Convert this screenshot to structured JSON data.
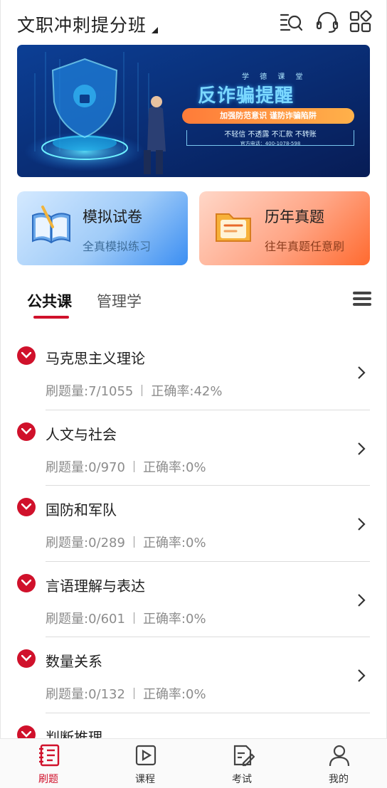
{
  "header": {
    "title": "文职冲刺提分班",
    "icons": [
      "search-list-icon",
      "headset-icon",
      "apps-grid-icon"
    ]
  },
  "banner": {
    "kicker": "学 德 课 堂",
    "headline": "反诈骗提醒",
    "pill": "加强防范意识 谨防诈骗陷阱",
    "slogan": "不轻信 不透露 不汇款 不转账",
    "phone": "官方电话：400-1078-598",
    "colors": {
      "background": "#0a2a6e",
      "accent": "#ff8a3d"
    }
  },
  "cards": {
    "mock": {
      "title": "模拟试卷",
      "subtitle": "全真模拟练习",
      "icon": "open-book-icon"
    },
    "past": {
      "title": "历年真题",
      "subtitle": "往年真题任意刷",
      "icon": "folder-icon"
    }
  },
  "tabs": {
    "items": [
      "公共课",
      "管理学"
    ],
    "active_index": 0,
    "menu_icon": "menu-icon"
  },
  "subjects": [
    {
      "name": "马克思主义理论",
      "count": "刷题量:7/1055",
      "accuracy": "正确率:42%"
    },
    {
      "name": "人文与社会",
      "count": "刷题量:0/970",
      "accuracy": "正确率:0%"
    },
    {
      "name": "国防和军队",
      "count": "刷题量:0/289",
      "accuracy": "正确率:0%"
    },
    {
      "name": "言语理解与表达",
      "count": "刷题量:0/601",
      "accuracy": "正确率:0%"
    },
    {
      "name": "数量关系",
      "count": "刷题量:0/132",
      "accuracy": "正确率:0%"
    },
    {
      "name": "判断推理",
      "count": "",
      "accuracy": ""
    }
  ],
  "bottom_nav": {
    "items": [
      {
        "label": "刷题",
        "icon": "practice-icon",
        "active": true
      },
      {
        "label": "课程",
        "icon": "video-icon",
        "active": false
      },
      {
        "label": "考试",
        "icon": "exam-icon",
        "active": false
      },
      {
        "label": "我的",
        "icon": "user-icon",
        "active": false
      }
    ]
  },
  "colors": {
    "accent": "#d0112b",
    "text": "#1f1f1f",
    "muted": "#8c8c8c"
  }
}
